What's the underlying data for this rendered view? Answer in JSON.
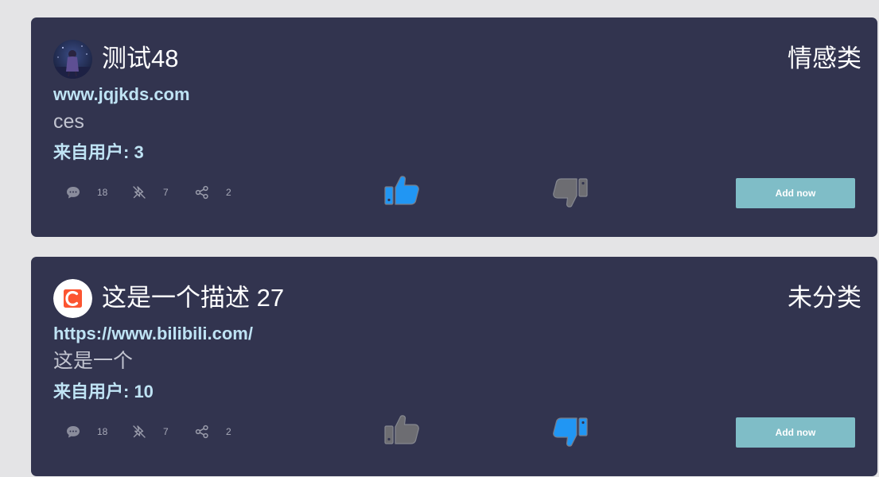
{
  "colors": {
    "page_bg": "#e4e4e6",
    "card_bg": "#32344f",
    "title": "#ffffff",
    "link": "#bfe3f4",
    "desc": "#c2c4d0",
    "stat_text": "#a7a9b8",
    "icon_grey": "#6d6d72",
    "accent_blue": "#2196f3",
    "button_bg": "#7fbdc7"
  },
  "cards": [
    {
      "title": "测试48",
      "category": "情感类",
      "url": "www.jqjkds.com",
      "description": "ces",
      "from_user": "来自用户: 3",
      "comments": "18",
      "pins": "7",
      "shares": "2",
      "liked": true,
      "disliked": false,
      "button_label": "Add now",
      "avatar": "night-scene-avatar"
    },
    {
      "title": "这是一个描述 27",
      "category": "未分类",
      "url": "https://www.bilibili.com/",
      "description": "这是一个",
      "from_user": "来自用户: 10",
      "comments": "18",
      "pins": "7",
      "shares": "2",
      "liked": false,
      "disliked": true,
      "button_label": "Add now",
      "avatar": "csdn-logo-avatar"
    }
  ]
}
